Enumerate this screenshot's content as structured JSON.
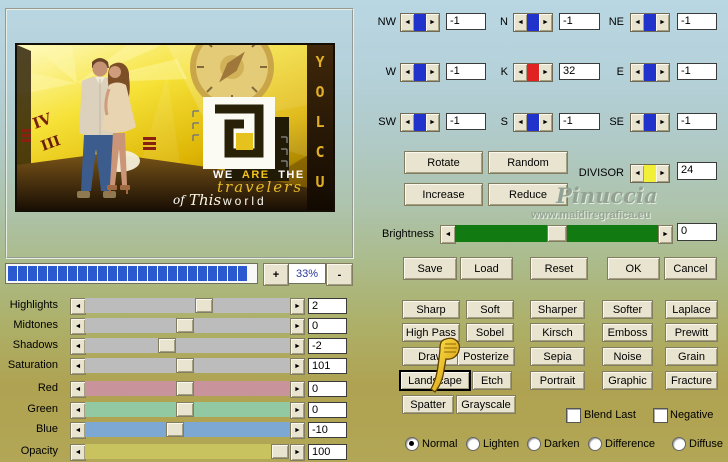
{
  "preview": {
    "zoom_in": "+",
    "zoom_level": "33%",
    "zoom_out": "-",
    "artwork": {
      "we": "WE",
      "are": "ARE",
      "the": "THE",
      "travelers": "travelers",
      "of": "of",
      "this": "This",
      "world": "world",
      "side_letters": [
        "Y",
        "O",
        "L",
        "C",
        "U"
      ],
      "numeral_iv": "IV",
      "numeral_iii": "III"
    }
  },
  "adjustments": {
    "rows": [
      {
        "label": "Highlights",
        "value": "2",
        "track_color": "#bcbcbc",
        "thumb_pos": "58%"
      },
      {
        "label": "Midtones",
        "value": "0",
        "track_color": "#bcbcbc",
        "thumb_pos": "49%"
      },
      {
        "label": "Shadows",
        "value": "-2",
        "track_color": "#bcbcbc",
        "thumb_pos": "40%"
      },
      {
        "label": "Saturation",
        "value": "101",
        "track_color": "#bcbcbc",
        "thumb_pos": "49%"
      },
      {
        "label": "Red",
        "value": "0",
        "track_color": "#c9939b",
        "thumb_pos": "49%"
      },
      {
        "label": "Green",
        "value": "0",
        "track_color": "#93c9a2",
        "thumb_pos": "49%"
      },
      {
        "label": "Blue",
        "value": "-10",
        "track_color": "#7ea8d4",
        "thumb_pos": "44%"
      },
      {
        "label": "Opacity",
        "value": "100",
        "track_color": "#c9c35f",
        "thumb_pos": "95%"
      }
    ]
  },
  "kernel": {
    "cells": [
      {
        "label": "NW",
        "value": "-1",
        "accent": "#2233cc"
      },
      {
        "label": "N",
        "value": "-1",
        "accent": "#2233cc"
      },
      {
        "label": "NE",
        "value": "-1",
        "accent": "#2233cc"
      },
      {
        "label": "W",
        "value": "-1",
        "accent": "#2233cc"
      },
      {
        "label": "K",
        "value": "32",
        "accent": "#e02222"
      },
      {
        "label": "E",
        "value": "-1",
        "accent": "#2233cc"
      },
      {
        "label": "SW",
        "value": "-1",
        "accent": "#2233cc"
      },
      {
        "label": "S",
        "value": "-1",
        "accent": "#2233cc"
      },
      {
        "label": "SE",
        "value": "-1",
        "accent": "#2233cc"
      }
    ],
    "divisor": {
      "label": "DIVISOR",
      "value": "24",
      "accent": "#f2ef38"
    }
  },
  "actions": {
    "rotate": "Rotate",
    "random": "Random",
    "increase": "Increase",
    "reduce": "Reduce"
  },
  "brightness": {
    "label": "Brightness",
    "value": "0",
    "thumb_pos": "50%",
    "track_color": "#117a11"
  },
  "watermark": {
    "name": "Pinuccia",
    "site": "www.maidiregrafica.eu"
  },
  "dialog_buttons": {
    "save": "Save",
    "load": "Load",
    "reset": "Reset",
    "ok": "OK",
    "cancel": "Cancel"
  },
  "filters": {
    "row1": [
      "Sharp",
      "Soft",
      "Sharper",
      "Softer",
      "Laplace"
    ],
    "row2": [
      "High Pass",
      "Sobel",
      "Kirsch",
      "Emboss",
      "Prewitt"
    ],
    "row3": [
      "Draw",
      "Posterize",
      "Sepia",
      "Noise",
      "Grain"
    ],
    "row4": [
      "Landscape",
      "Etch",
      "Portrait",
      "Graphic",
      "Fracture"
    ],
    "row5": [
      "Spatter",
      "Grayscale"
    ],
    "focused": "Landscape"
  },
  "options": {
    "blend_last": "Blend Last",
    "negative": "Negative"
  },
  "modes": [
    {
      "label": "Normal",
      "selected": true
    },
    {
      "label": "Lighten",
      "selected": false
    },
    {
      "label": "Darken",
      "selected": false
    },
    {
      "label": "Difference",
      "selected": false
    },
    {
      "label": "Diffuse",
      "selected": false
    }
  ]
}
